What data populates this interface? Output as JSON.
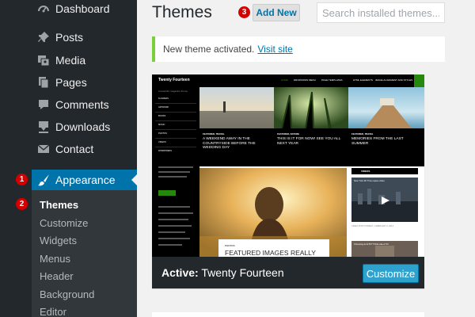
{
  "sidebar": {
    "items": [
      {
        "label": "Dashboard",
        "icon": "dashboard-icon"
      },
      {
        "label": "Posts",
        "icon": "pin-icon"
      },
      {
        "label": "Media",
        "icon": "media-icon"
      },
      {
        "label": "Pages",
        "icon": "pages-icon"
      },
      {
        "label": "Comments",
        "icon": "comment-icon"
      },
      {
        "label": "Downloads",
        "icon": "download-icon"
      },
      {
        "label": "Contact",
        "icon": "mail-icon"
      },
      {
        "label": "Appearance",
        "icon": "paintbrush-icon"
      }
    ],
    "submenu": [
      "Themes",
      "Customize",
      "Widgets",
      "Menus",
      "Header",
      "Background",
      "Editor"
    ]
  },
  "markers": [
    "1",
    "2",
    "3"
  ],
  "header": {
    "title": "Themes",
    "add_new": "Add New",
    "search_placeholder": "Search installed themes..."
  },
  "notice": {
    "text": "New theme activated.",
    "link": "Visit site"
  },
  "theme": {
    "active_prefix": "Active:",
    "name": "Twenty Fourteen",
    "customize_label": "Customize"
  },
  "preview": {
    "brand": "Twenty Fourteen",
    "tagline": "A beautiful magazine theme",
    "menu": [
      "HOME",
      "DROPDOWN MENU",
      "PAGE TEMPLATES",
      "HTML ELEMENTS",
      "IMAGE ALIGNMENT AND STYLES"
    ],
    "left_menu": [
      "FLOWERS",
      "ARTWORK",
      "BOOKS",
      "MUSIC",
      "PHOTOS",
      "VIDEOS",
      "WORDPRESS"
    ],
    "features": [
      {
        "category": "FEATURED, TRAVEL",
        "title": "A WEEKEND AWAY IN THE COUNTRYSIDE BEFORE THE WEDDING DAY"
      },
      {
        "category": "FEATURED, NATURE",
        "title": "THIS IS IT FOR NOW! SEE YOU ALL NEXT YEAR"
      },
      {
        "category": "FEATURED, TRAVEL",
        "title": "MEMORIES FROM THE LAST SUMMER"
      }
    ],
    "article_category": "PHOTOS",
    "article_title": "FEATURED IMAGES REALLY",
    "videos_label": "VIDEOS",
    "video1_title": "New York 4K Time Lapse video",
    "video1_caption": "VIDEO POST FORMAT - FEBRUARY 6, 2014",
    "video2_title": "Choosing an ETF? Think Like A Tilt"
  }
}
